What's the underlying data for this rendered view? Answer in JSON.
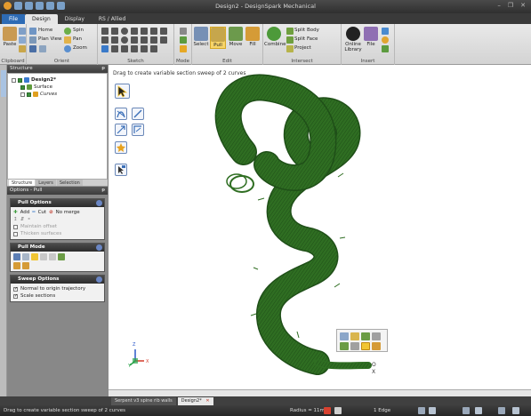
{
  "window": {
    "title": "Design2 - DesignSpark Mechanical",
    "minimize": "–",
    "restore": "❐",
    "close": "✕"
  },
  "ribbon_tabs": [
    "File",
    "Design",
    "Display",
    "RS / Allied"
  ],
  "ribbon": {
    "clipboard": {
      "label": "Clipboard",
      "paste": "Paste"
    },
    "orient": {
      "label": "Orient",
      "home": "Home",
      "spin": "Spin",
      "plan_view": "Plan View",
      "pan": "Pan",
      "zoom": "Zoom"
    },
    "sketch": {
      "label": "Sketch"
    },
    "mode": {
      "label": "Mode"
    },
    "edit": {
      "label": "Edit",
      "select": "Select",
      "pull": "Pull",
      "move": "Move",
      "fill": "Fill"
    },
    "intersect": {
      "label": "Intersect",
      "combine": "Combine",
      "split_body": "Split Body",
      "split_face": "Split Face",
      "project": "Project"
    },
    "insert": {
      "label": "Insert",
      "online_library": "Online Library",
      "file": "File"
    }
  },
  "structure_panel": {
    "title": "Structure",
    "pin": "ᵽ",
    "tree": [
      {
        "label": "Design2*",
        "level": 0
      },
      {
        "label": "Surface",
        "level": 1
      },
      {
        "label": "Curves",
        "level": 1
      }
    ],
    "tabs": [
      "Structure",
      "Layers",
      "Selection"
    ]
  },
  "options_panel": {
    "title": "Options - Pull",
    "pin": "ᵽ",
    "pull_options": {
      "title": "Pull Options",
      "add": "Add",
      "cut": "Cut",
      "no_merge": "No merge",
      "maintain_offset": "Maintain offset",
      "thicken_surfaces": "Thicken surfaces"
    },
    "pull_mode": {
      "title": "Pull Mode"
    },
    "sweep_options": {
      "title": "Sweep Options",
      "normal_to_origin": "Normal to origin trajectory",
      "scale_sections": "Scale sections",
      "normal_checked": true,
      "scale_checked": true
    }
  },
  "viewport": {
    "hint": "Drag to create variable section sweep of 2 curves",
    "axis_z": "Z",
    "axis_y": "Y",
    "axis_x": "X",
    "origin_o": "O",
    "origin_x": "X",
    "shape_color": "#2f6e22",
    "shape_outline": "#1f4f18"
  },
  "document_tabs": [
    {
      "label": "Serpent v3 spine rib walls",
      "active": false
    },
    {
      "label": "Design2*",
      "active": true
    }
  ],
  "status": {
    "message": "Drag to create variable section sweep of 2 curves",
    "radius": "Radius = 11mm",
    "edges": "1 Edge"
  }
}
